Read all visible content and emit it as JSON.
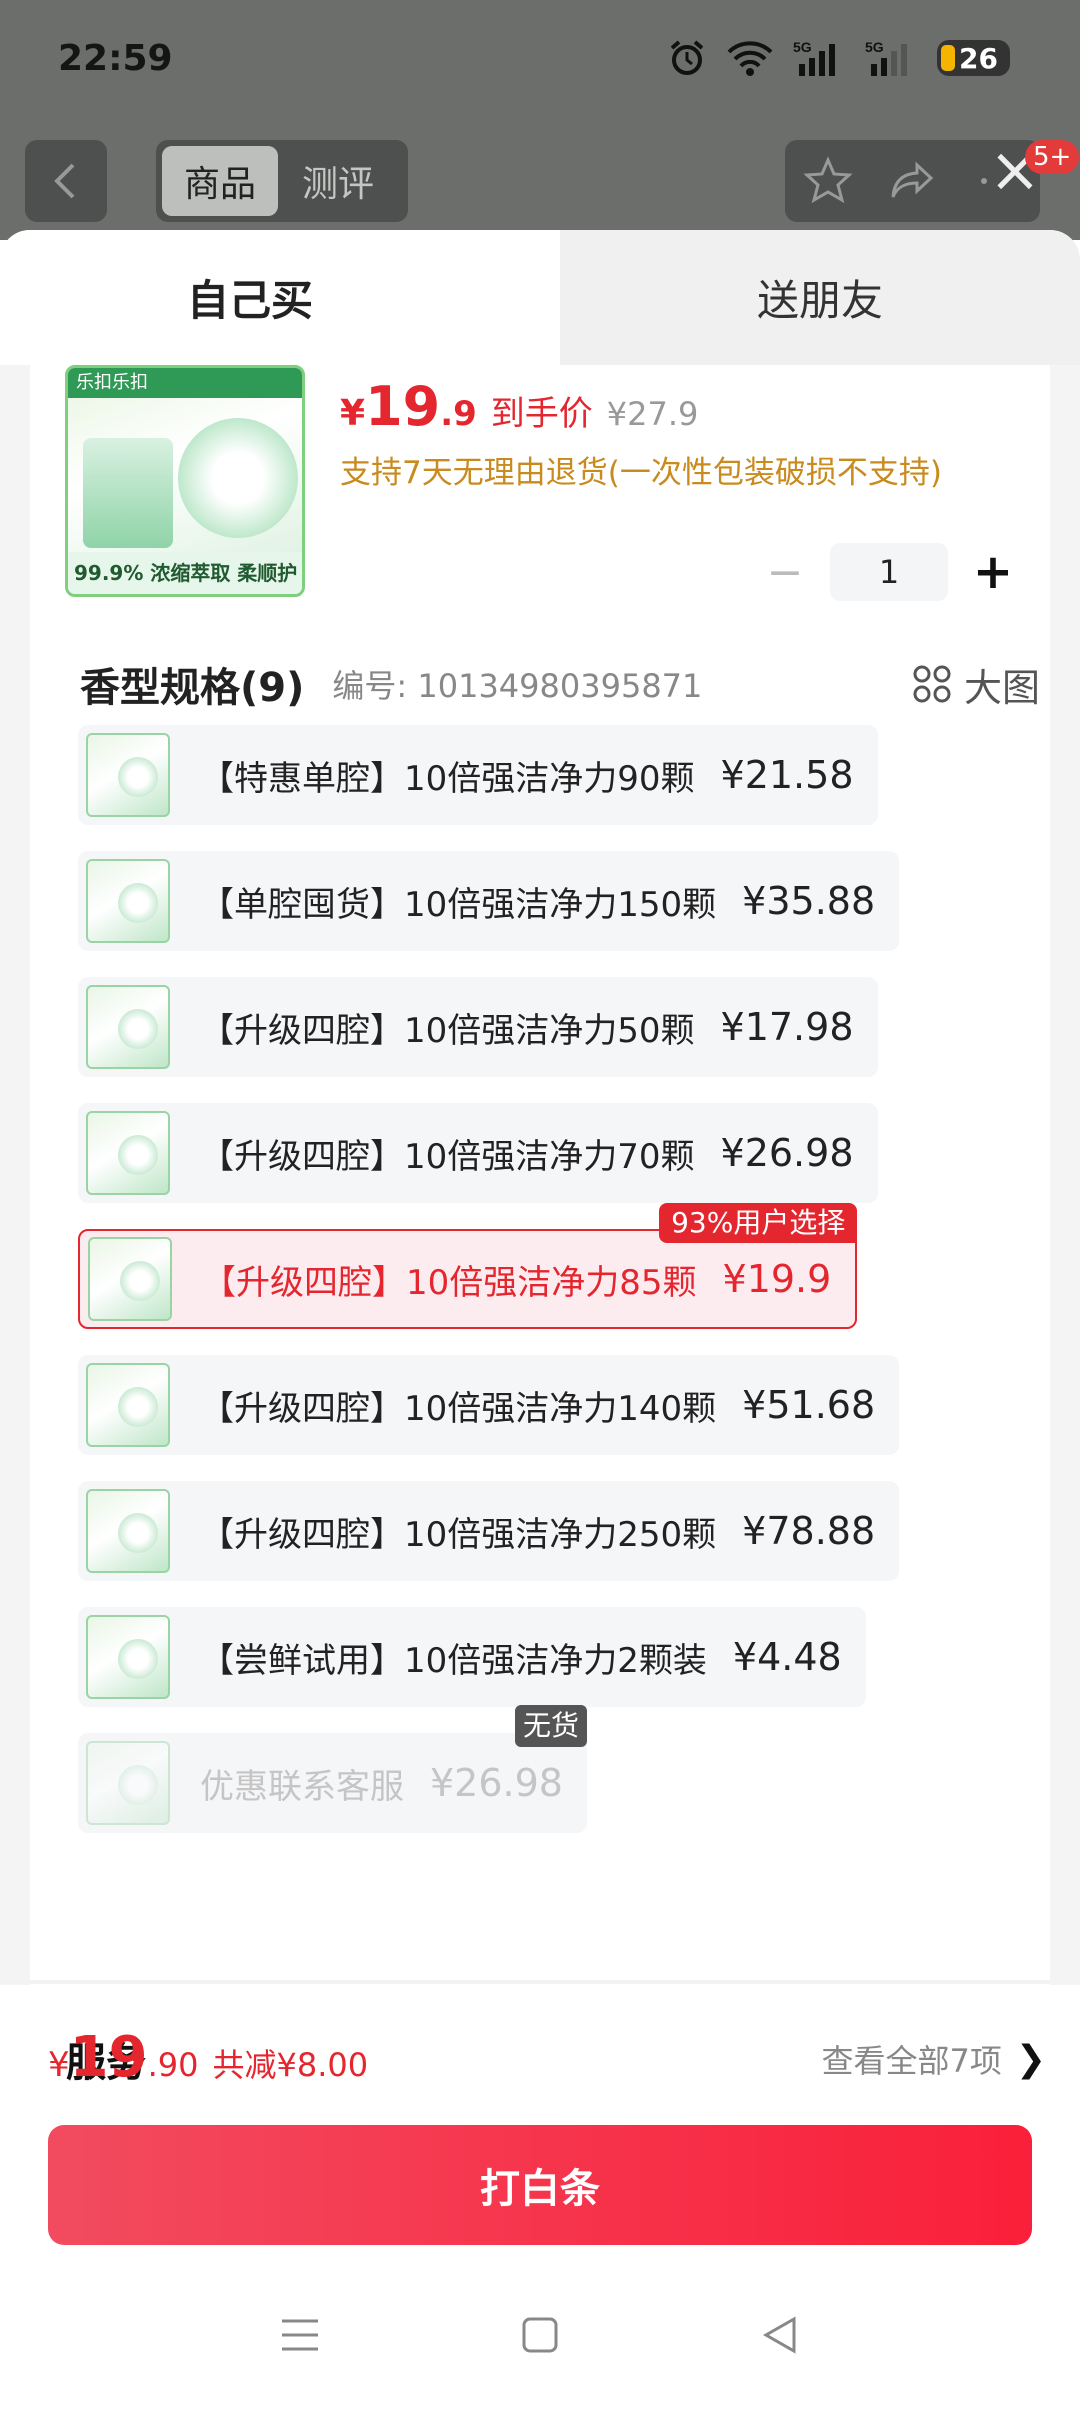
{
  "status": {
    "time": "22:59",
    "battery": "26"
  },
  "header": {
    "tabs": [
      "商品",
      "测评"
    ],
    "badge": "5+"
  },
  "sheet": {
    "tabs": {
      "self": "自己买",
      "friend": "送朋友"
    },
    "product": {
      "image_banner": "乐扣乐扣",
      "image_footer": "99.9% 浓缩萃取 柔顺护衣",
      "price_yen": "¥",
      "price_int": "19",
      "price_dec": ".9",
      "price_label": "到手价",
      "price_old": "¥27.9",
      "refund_note": "支持7天无理由退货(一次性包装破损不支持)",
      "qty": "1",
      "qty_minus": "−",
      "qty_plus": "+"
    },
    "spec": {
      "title": "香型规格(9)",
      "code": "编号: 10134980395871",
      "view_label": "大图",
      "options": [
        {
          "label": "【特惠单腔】10倍强洁净力90颗",
          "price": "¥21.58"
        },
        {
          "label": "【单腔囤货】10倍强洁净力150颗",
          "price": "¥35.88"
        },
        {
          "label": "【升级四腔】10倍强洁净力50颗",
          "price": "¥17.98"
        },
        {
          "label": "【升级四腔】10倍强洁净力70颗",
          "price": "¥26.98"
        },
        {
          "label": "【升级四腔】10倍强洁净力85颗",
          "price": "¥19.9",
          "tag": "93%用户选择"
        },
        {
          "label": "【升级四腔】10倍强洁净力140颗",
          "price": "¥51.68"
        },
        {
          "label": "【升级四腔】10倍强洁净力250颗",
          "price": "¥78.88"
        },
        {
          "label": "【尝鲜试用】10倍强洁净力2颗装",
          "price": "¥4.48"
        },
        {
          "label": "优惠联系客服",
          "price": "¥26.98",
          "tag": "无货"
        }
      ]
    },
    "service": {
      "title": "服务",
      "all": "查看全部7项",
      "chevron": "❯"
    },
    "footer": {
      "yen": "¥",
      "total_int": "19",
      "total_dec": ".90",
      "discount": "共减¥8.00",
      "pay_button": "打白条"
    }
  },
  "colors": {
    "accent": "#e4262f",
    "gold": "#c98a1e"
  }
}
